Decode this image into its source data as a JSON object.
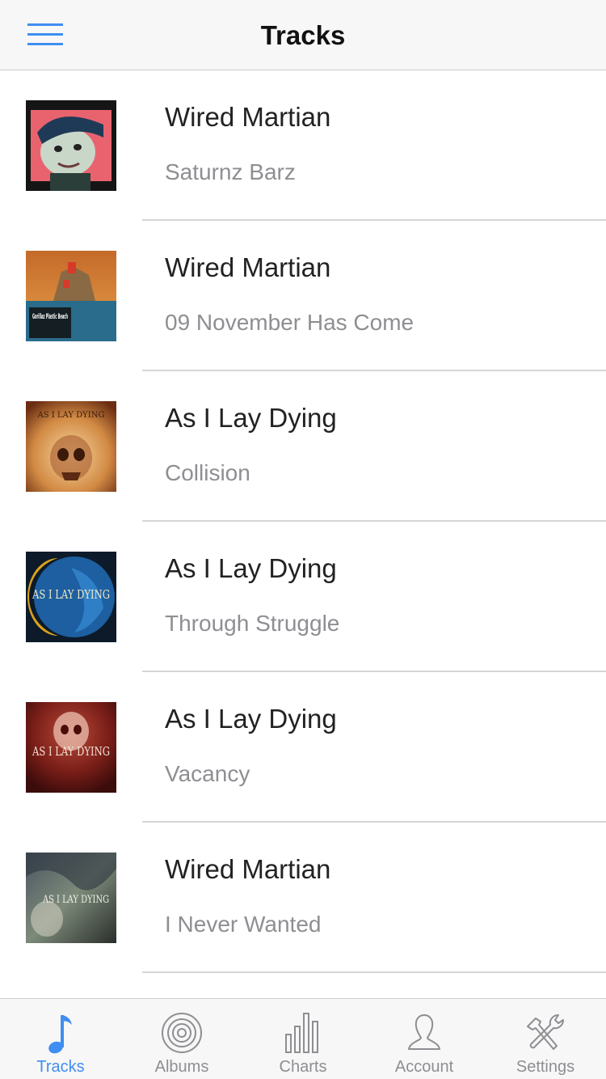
{
  "header": {
    "title": "Tracks",
    "menu_icon": "hamburger-icon"
  },
  "tracks": [
    {
      "title": "Wired Martian",
      "subtitle": "Saturnz Barz",
      "art_icon": "album-art"
    },
    {
      "title": "Wired Martian",
      "subtitle": "09 November Has Come",
      "art_icon": "album-art"
    },
    {
      "title": "As I Lay Dying",
      "subtitle": "Collision",
      "art_icon": "album-art"
    },
    {
      "title": "As I Lay Dying",
      "subtitle": "Through Struggle",
      "art_icon": "album-art"
    },
    {
      "title": "As I Lay Dying",
      "subtitle": "Vacancy",
      "art_icon": "album-art"
    },
    {
      "title": "Wired Martian",
      "subtitle": "I Never Wanted",
      "art_icon": "album-art"
    }
  ],
  "album_art_text": {
    "art2": "Gorillaz Plastic Beach",
    "art3": "AS I LAY DYING",
    "art4": "AS I LAY DYING",
    "art5": "AS I LAY DYING",
    "art6": "AS I LAY DYING"
  },
  "tabbar": {
    "tabs": [
      {
        "label": "Tracks",
        "icon": "music-note-icon",
        "active": true
      },
      {
        "label": "Albums",
        "icon": "vinyl-disc-icon",
        "active": false
      },
      {
        "label": "Charts",
        "icon": "bar-chart-icon",
        "active": false
      },
      {
        "label": "Account",
        "icon": "user-icon",
        "active": false
      },
      {
        "label": "Settings",
        "icon": "tools-icon",
        "active": false
      }
    ]
  },
  "colors": {
    "accent": "#3f8ef0",
    "inactive": "#8e8e93",
    "bar_background": "#f7f7f7",
    "separator": "#d6d6d6"
  }
}
